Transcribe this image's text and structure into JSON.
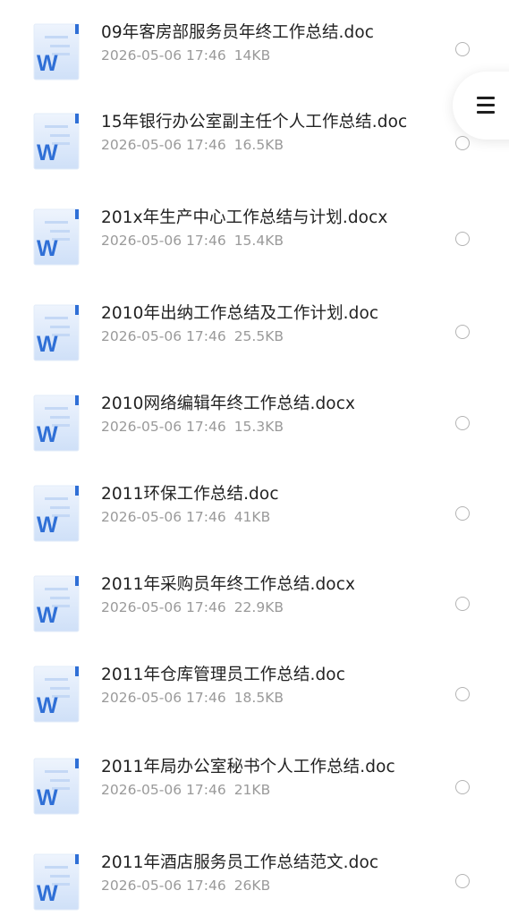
{
  "files": [
    {
      "name": "09年客房部服务员年终工作总结.doc",
      "date": "2026-05-06 17:46",
      "size": "14KB",
      "icon": "word-doc-icon"
    },
    {
      "name": "15年银行办公室副主任个人工作总结.doc",
      "date": "2026-05-06 17:46",
      "size": "16.5KB",
      "icon": "word-doc-icon"
    },
    {
      "name": "201x年生产中心工作总结与计划.docx",
      "date": "2026-05-06 17:46",
      "size": "15.4KB",
      "icon": "word-doc-icon"
    },
    {
      "name": "2010年出纳工作总结及工作计划.doc",
      "date": "2026-05-06 17:46",
      "size": "25.5KB",
      "icon": "word-doc-icon"
    },
    {
      "name": "2010网络编辑年终工作总结.docx",
      "date": "2026-05-06 17:46",
      "size": "15.3KB",
      "icon": "word-doc-icon"
    },
    {
      "name": "2011环保工作总结.doc",
      "date": "2026-05-06 17:46",
      "size": "41KB",
      "icon": "word-doc-icon"
    },
    {
      "name": "2011年采购员年终工作总结.docx",
      "date": "2026-05-06 17:46",
      "size": "22.9KB",
      "icon": "word-doc-icon"
    },
    {
      "name": "2011年仓库管理员工作总结.doc",
      "date": "2026-05-06 17:46",
      "size": "18.5KB",
      "icon": "word-doc-icon"
    },
    {
      "name": "2011年局办公室秘书个人工作总结.doc",
      "date": "2026-05-06 17:46",
      "size": "21KB",
      "icon": "word-doc-icon"
    },
    {
      "name": "2011年酒店服务员工作总结范文.doc",
      "date": "2026-05-06 17:46",
      "size": "26KB",
      "icon": "word-doc-icon"
    }
  ],
  "menu_button": {
    "icon": "hamburger-menu-icon"
  },
  "colors": {
    "word_blue": "#2f6fd6",
    "doc_light": "#dbe8fb",
    "name_text": "#222222",
    "meta_text": "#9a9a9a",
    "radio_border": "#b4b4b4"
  }
}
